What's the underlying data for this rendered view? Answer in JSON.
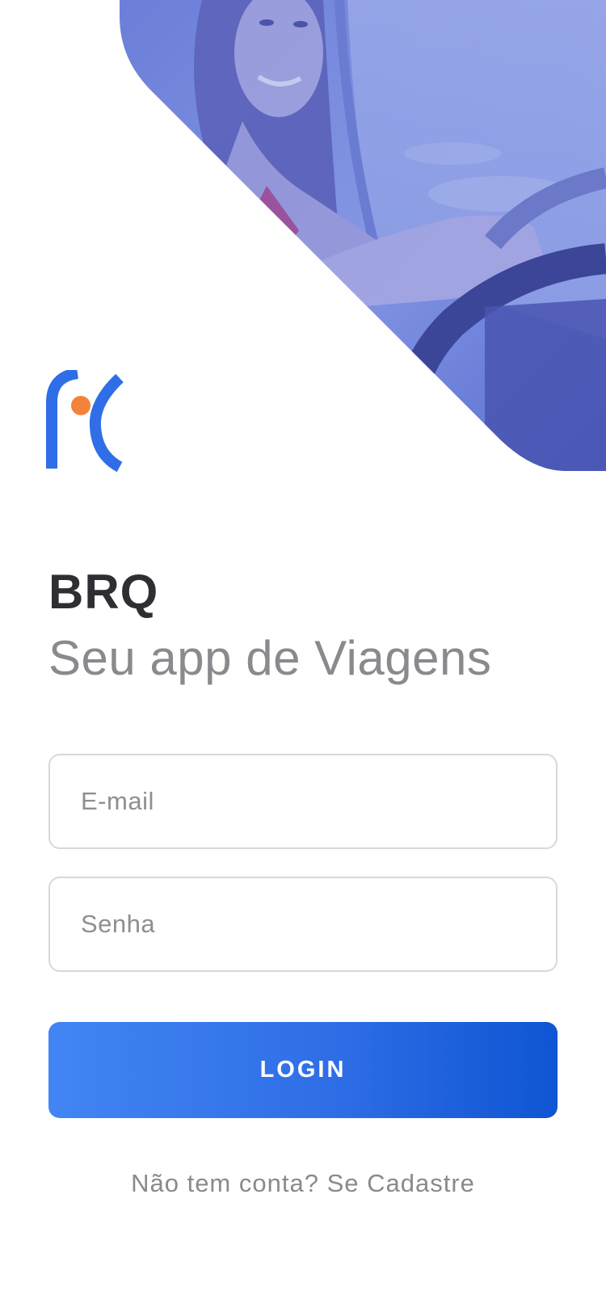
{
  "brand": {
    "name": "BRQ",
    "tagline": "Seu app de Viagens"
  },
  "form": {
    "email_placeholder": "E-mail",
    "password_placeholder": "Senha",
    "login_label": "LOGIN"
  },
  "footer": {
    "signup_prompt": "Não tem conta?",
    "signup_link": "Se Cadastre"
  },
  "colors": {
    "accent_blue": "#2f6ee6",
    "logo_orange": "#f5823c",
    "hero_tint": "#6f86e0"
  },
  "icons": {
    "logo": "brq-logo-icon"
  }
}
